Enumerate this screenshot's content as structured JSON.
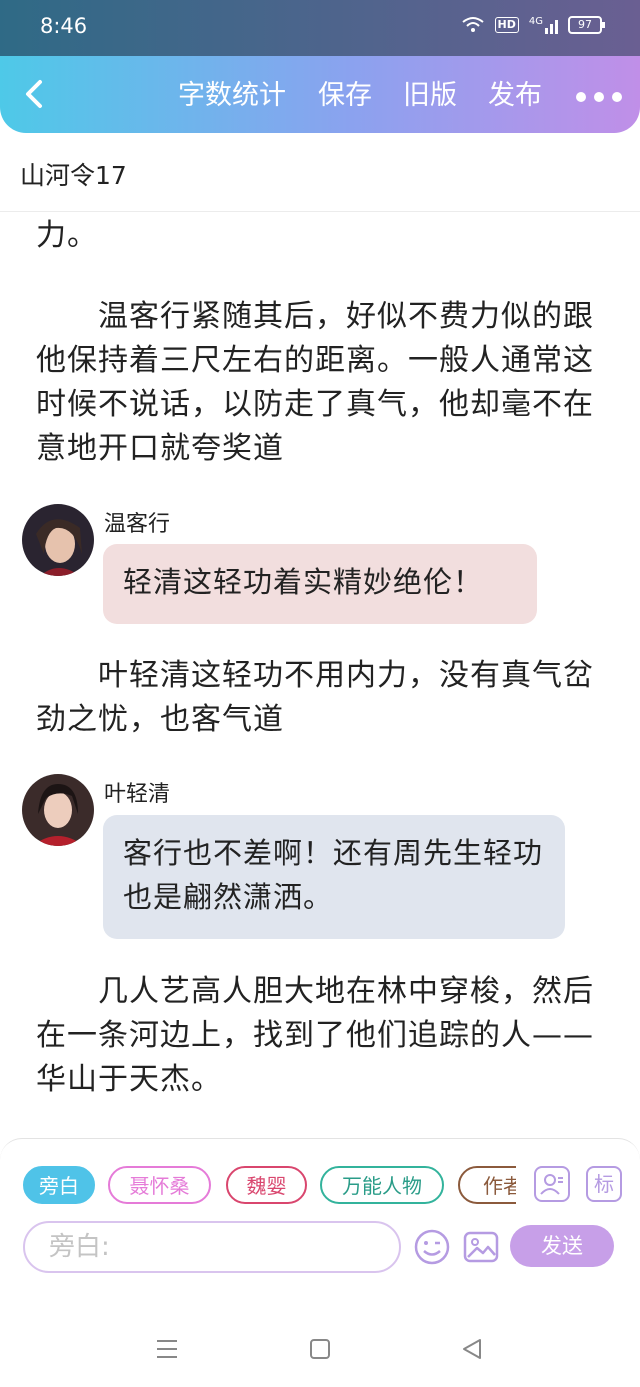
{
  "status_bar": {
    "time": "8:46",
    "hd": "HD",
    "network": "4G",
    "battery": "97"
  },
  "toolbar": {
    "word_count": "字数统计",
    "save": "保存",
    "old_version": "旧版",
    "publish": "发布"
  },
  "doc_title": "山河令17",
  "content": {
    "para0": "力。",
    "para1": "　　温客行紧随其后，好似不费力似的跟他保持着三尺左右的距离。一般人通常这时候不说话，以防走了真气，他却毫不在意地开口就夸奖道",
    "dialog1": {
      "speaker": "温客行",
      "text": "轻清这轻功着实精妙绝伦！",
      "bubble_color": "#f2dede"
    },
    "para2": "　　叶轻清这轻功不用内力，没有真气岔劲之忧，也客气道",
    "dialog2": {
      "speaker": "叶轻清",
      "text": "客行也不差啊！还有周先生轻功也是翩然潇洒。",
      "bubble_color": "#e0e5ee"
    },
    "para3": "　　几人艺高人胆大地在林中穿梭，然后在一条河边上，找到了他们追踪的人——华山于天杰。"
  },
  "character_chips": [
    {
      "label": "旁白",
      "color": "#4fc3e8",
      "selected": true
    },
    {
      "label": "聂怀桑",
      "color": "#e57bd8",
      "selected": false
    },
    {
      "label": "魏婴",
      "color": "#d9466e",
      "selected": false
    },
    {
      "label": "万能人物",
      "color": "#33b39c",
      "selected": false
    },
    {
      "label": "作者",
      "color": "#8b5a3c",
      "selected": false
    }
  ],
  "side_buttons": {
    "tag": "标"
  },
  "input": {
    "placeholder": "旁白:"
  },
  "send_label": "发送",
  "colors": {
    "accent": "#c79fe8",
    "toolbar_start": "#4ec9e8",
    "toolbar_end": "#c08fe8"
  }
}
